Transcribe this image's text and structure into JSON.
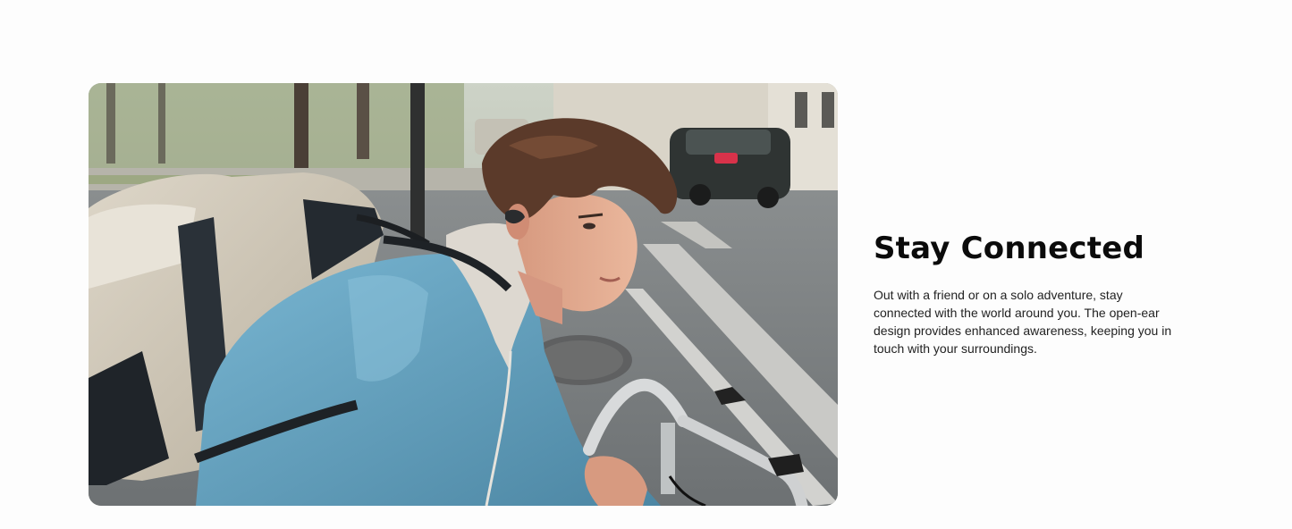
{
  "feature": {
    "image_alt": "Young man riding a bicycle in the city wearing open-ear earbuds and a backpack",
    "heading": "Stay Connected",
    "body": "Out with a friend or on a solo adventure, stay connected with the world around you. The open-ear design provides enhanced awareness, keeping you in touch with your surroundings."
  },
  "colors": {
    "page_background": "#fdfdfd",
    "heading_text": "#0b0b0b",
    "body_text": "#222222",
    "jacket_blue": "#5f9dbb"
  }
}
